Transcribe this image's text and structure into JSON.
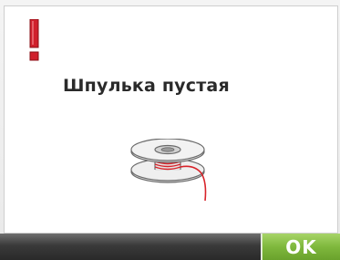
{
  "dialog": {
    "message": "Шпулька пустая"
  },
  "footer": {
    "ok_label": "OK"
  },
  "icons": {
    "alert": "exclamation-alert-icon",
    "bobbin": "empty-bobbin-icon"
  },
  "colors": {
    "alert_red": "#d0202c",
    "thread_red": "#d8232a",
    "ok_green": "#7fb83d",
    "footer_dark": "#3a3a3a"
  }
}
